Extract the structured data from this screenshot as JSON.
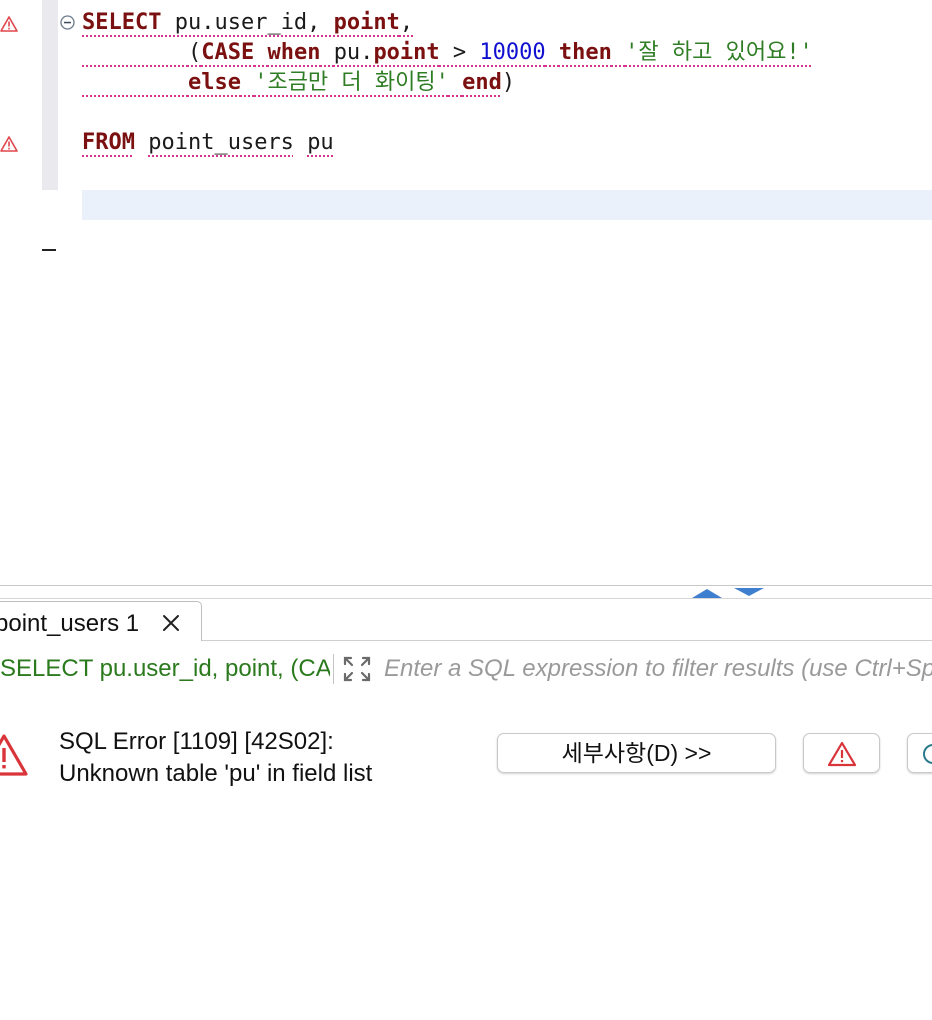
{
  "editor": {
    "line1": {
      "select_kw": "SELECT",
      "cols": " pu.user_id, ",
      "point": "point",
      "comma": ","
    },
    "line2": {
      "indent": "        ",
      "open": "(",
      "case_kw": "CASE",
      "when_kw": "when",
      "ref": "pu.",
      "point": "point",
      "gt": " > ",
      "number": "10000",
      "then_kw": "then",
      "string": "'잘 하고 있어요!'"
    },
    "line3": {
      "indent": "        ",
      "else_kw": "else",
      "string": "'조금만 더 화이팅'",
      "end_kw": "end",
      "close": ")"
    },
    "line4": {
      "from_kw": "FROM",
      "table": "point_users",
      "alias": "pu"
    }
  },
  "results": {
    "tab_label": "point_users 1",
    "query_text": "SELECT pu.user_id, point, (CASE",
    "filter_placeholder": "Enter a SQL expression to filter results (use Ctrl+Space)",
    "error_line1": "SQL Error [1109] [42S02]:",
    "error_line2": "Unknown table 'pu' in field list",
    "details_button": "세부사항(D) >>"
  },
  "colors": {
    "keyword": "#7b1010",
    "number": "#1010d0",
    "string": "#2f7d24",
    "error_red": "#d9343a",
    "squiggle": "#d6338e"
  }
}
